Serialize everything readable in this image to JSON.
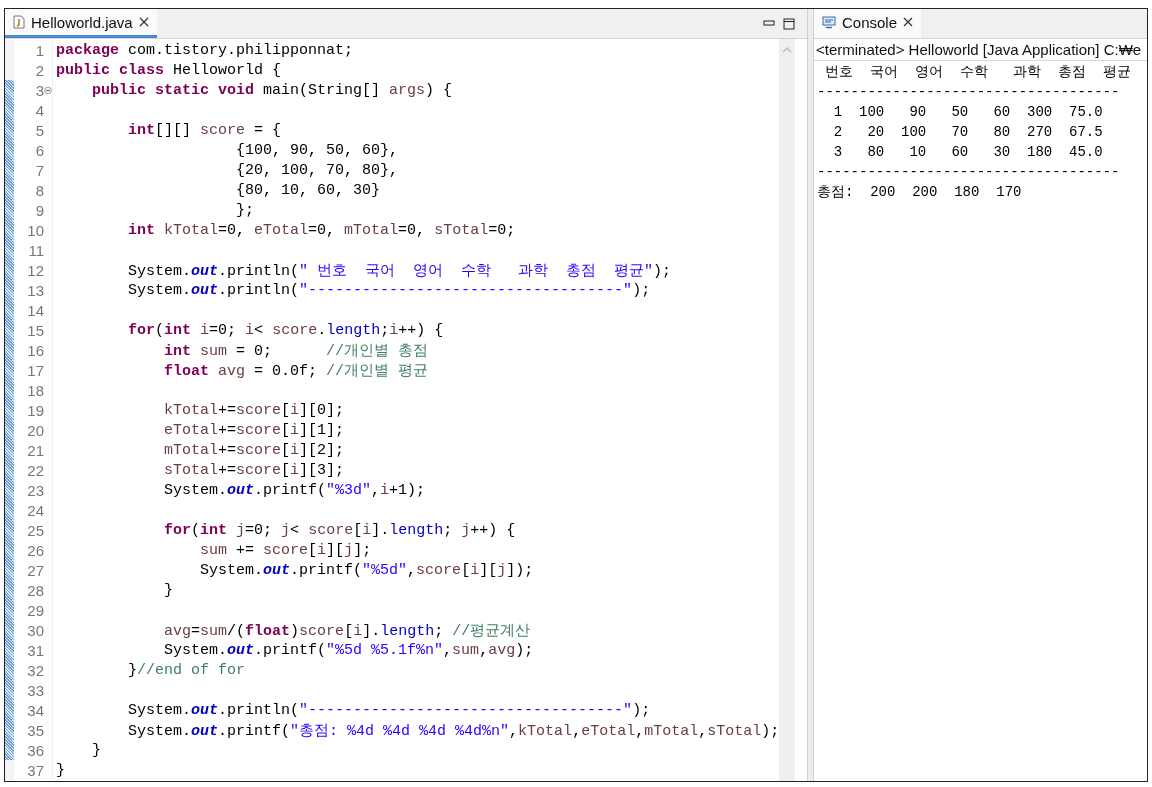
{
  "editor": {
    "tab": {
      "title": "Helloworld.java",
      "active": true
    },
    "lines": [
      {
        "number": "1",
        "fold": false,
        "marked": false,
        "tokens": [
          {
            "kind": "keyword",
            "text": "package"
          },
          {
            "kind": "plain",
            "text": " com.tistory.philipponnat;"
          }
        ]
      },
      {
        "number": "2",
        "fold": false,
        "marked": false,
        "tokens": [
          {
            "kind": "keyword",
            "text": "public class"
          },
          {
            "kind": "plain",
            "text": " Helloworld {"
          }
        ]
      },
      {
        "number": "3",
        "fold": true,
        "marked": true,
        "tokens": [
          {
            "kind": "keyword",
            "text": "    public static void"
          },
          {
            "kind": "plain",
            "text": " main(String[] "
          },
          {
            "kind": "variable",
            "text": "args"
          },
          {
            "kind": "plain",
            "text": ") {"
          }
        ]
      },
      {
        "number": "4",
        "fold": false,
        "marked": true
      },
      {
        "number": "5",
        "fold": false,
        "marked": true,
        "tokens": [
          {
            "kind": "keyword",
            "text": "        int"
          },
          {
            "kind": "plain",
            "text": "[][] "
          },
          {
            "kind": "variable",
            "text": "score"
          },
          {
            "kind": "plain",
            "text": " = {"
          }
        ]
      },
      {
        "number": "6",
        "fold": false,
        "marked": true,
        "tokens": [
          {
            "kind": "plain",
            "text": "                    {100, 90, 50, 60},"
          }
        ]
      },
      {
        "number": "7",
        "fold": false,
        "marked": true,
        "tokens": [
          {
            "kind": "plain",
            "text": "                    {20, 100, 70, 80},"
          }
        ]
      },
      {
        "number": "8",
        "fold": false,
        "marked": true,
        "tokens": [
          {
            "kind": "plain",
            "text": "                    {80, 10, 60, 30}"
          }
        ]
      },
      {
        "number": "9",
        "fold": false,
        "marked": true,
        "tokens": [
          {
            "kind": "plain",
            "text": "                    };"
          }
        ]
      },
      {
        "number": "10",
        "fold": false,
        "marked": true,
        "tokens": [
          {
            "kind": "keyword",
            "text": "        int "
          },
          {
            "kind": "variable",
            "text": "kTotal"
          },
          {
            "kind": "plain",
            "text": "=0, "
          },
          {
            "kind": "variable",
            "text": "eTotal"
          },
          {
            "kind": "plain",
            "text": "=0, "
          },
          {
            "kind": "variable",
            "text": "mTotal"
          },
          {
            "kind": "plain",
            "text": "=0, "
          },
          {
            "kind": "variable",
            "text": "sTotal"
          },
          {
            "kind": "plain",
            "text": "=0;"
          }
        ]
      },
      {
        "number": "11",
        "fold": false,
        "marked": true
      },
      {
        "number": "12",
        "fold": false,
        "marked": true,
        "tokens": [
          {
            "kind": "plain",
            "text": "        System."
          },
          {
            "kind": "static",
            "text": "out"
          },
          {
            "kind": "plain",
            "text": ".println("
          },
          {
            "kind": "string",
            "text": "\" 번호  국어  영어  수학   과학  총점  평균\""
          },
          {
            "kind": "plain",
            "text": ");"
          }
        ]
      },
      {
        "number": "13",
        "fold": false,
        "marked": true,
        "tokens": [
          {
            "kind": "plain",
            "text": "        System."
          },
          {
            "kind": "static",
            "text": "out"
          },
          {
            "kind": "plain",
            "text": ".println("
          },
          {
            "kind": "string",
            "text": "\"-----------------------------------\""
          },
          {
            "kind": "plain",
            "text": ");"
          }
        ]
      },
      {
        "number": "14",
        "fold": false,
        "marked": true
      },
      {
        "number": "15",
        "fold": false,
        "marked": true,
        "tokens": [
          {
            "kind": "keyword",
            "text": "        for"
          },
          {
            "kind": "plain",
            "text": "("
          },
          {
            "kind": "keyword",
            "text": "int "
          },
          {
            "kind": "variable",
            "text": "i"
          },
          {
            "kind": "plain",
            "text": "=0; "
          },
          {
            "kind": "variable",
            "text": "i"
          },
          {
            "kind": "plain",
            "text": "< "
          },
          {
            "kind": "variable",
            "text": "score"
          },
          {
            "kind": "plain",
            "text": "."
          },
          {
            "kind": "field",
            "text": "length"
          },
          {
            "kind": "plain",
            "text": ";"
          },
          {
            "kind": "variable",
            "text": "i"
          },
          {
            "kind": "plain",
            "text": "++) {"
          }
        ]
      },
      {
        "number": "16",
        "fold": false,
        "marked": true,
        "tokens": [
          {
            "kind": "keyword",
            "text": "            int "
          },
          {
            "kind": "variable",
            "text": "sum"
          },
          {
            "kind": "plain",
            "text": " = 0;      "
          },
          {
            "kind": "comment",
            "text": "//개인별 총점"
          }
        ]
      },
      {
        "number": "17",
        "fold": false,
        "marked": true,
        "tokens": [
          {
            "kind": "keyword",
            "text": "            float "
          },
          {
            "kind": "variable",
            "text": "avg"
          },
          {
            "kind": "plain",
            "text": " = 0.0f; "
          },
          {
            "kind": "comment",
            "text": "//개인별 평균"
          }
        ]
      },
      {
        "number": "18",
        "fold": false,
        "marked": true
      },
      {
        "number": "19",
        "fold": false,
        "marked": true,
        "tokens": [
          {
            "kind": "variable",
            "text": "            kTotal"
          },
          {
            "kind": "plain",
            "text": "+="
          },
          {
            "kind": "variable",
            "text": "score"
          },
          {
            "kind": "plain",
            "text": "["
          },
          {
            "kind": "variable",
            "text": "i"
          },
          {
            "kind": "plain",
            "text": "][0];"
          }
        ]
      },
      {
        "number": "20",
        "fold": false,
        "marked": true,
        "tokens": [
          {
            "kind": "variable",
            "text": "            eTotal"
          },
          {
            "kind": "plain",
            "text": "+="
          },
          {
            "kind": "variable",
            "text": "score"
          },
          {
            "kind": "plain",
            "text": "["
          },
          {
            "kind": "variable",
            "text": "i"
          },
          {
            "kind": "plain",
            "text": "][1];"
          }
        ]
      },
      {
        "number": "21",
        "fold": false,
        "marked": true,
        "tokens": [
          {
            "kind": "variable",
            "text": "            mTotal"
          },
          {
            "kind": "plain",
            "text": "+="
          },
          {
            "kind": "variable",
            "text": "score"
          },
          {
            "kind": "plain",
            "text": "["
          },
          {
            "kind": "variable",
            "text": "i"
          },
          {
            "kind": "plain",
            "text": "][2];"
          }
        ]
      },
      {
        "number": "22",
        "fold": false,
        "marked": true,
        "tokens": [
          {
            "kind": "variable",
            "text": "            sTotal"
          },
          {
            "kind": "plain",
            "text": "+="
          },
          {
            "kind": "variable",
            "text": "score"
          },
          {
            "kind": "plain",
            "text": "["
          },
          {
            "kind": "variable",
            "text": "i"
          },
          {
            "kind": "plain",
            "text": "][3];"
          }
        ]
      },
      {
        "number": "23",
        "fold": false,
        "marked": true,
        "tokens": [
          {
            "kind": "plain",
            "text": "            System."
          },
          {
            "kind": "static",
            "text": "out"
          },
          {
            "kind": "plain",
            "text": ".printf("
          },
          {
            "kind": "string",
            "text": "\"%3d\""
          },
          {
            "kind": "plain",
            "text": ","
          },
          {
            "kind": "variable",
            "text": "i"
          },
          {
            "kind": "plain",
            "text": "+1);"
          }
        ]
      },
      {
        "number": "24",
        "fold": false,
        "marked": true
      },
      {
        "number": "25",
        "fold": false,
        "marked": true,
        "tokens": [
          {
            "kind": "keyword",
            "text": "            for"
          },
          {
            "kind": "plain",
            "text": "("
          },
          {
            "kind": "keyword",
            "text": "int "
          },
          {
            "kind": "variable",
            "text": "j"
          },
          {
            "kind": "plain",
            "text": "=0; "
          },
          {
            "kind": "variable",
            "text": "j"
          },
          {
            "kind": "plain",
            "text": "< "
          },
          {
            "kind": "variable",
            "text": "score"
          },
          {
            "kind": "plain",
            "text": "["
          },
          {
            "kind": "variable",
            "text": "i"
          },
          {
            "kind": "plain",
            "text": "]."
          },
          {
            "kind": "field",
            "text": "length"
          },
          {
            "kind": "plain",
            "text": "; "
          },
          {
            "kind": "variable",
            "text": "j"
          },
          {
            "kind": "plain",
            "text": "++) {"
          }
        ]
      },
      {
        "number": "26",
        "fold": false,
        "marked": true,
        "tokens": [
          {
            "kind": "variable",
            "text": "                sum"
          },
          {
            "kind": "plain",
            "text": " += "
          },
          {
            "kind": "variable",
            "text": "score"
          },
          {
            "kind": "plain",
            "text": "["
          },
          {
            "kind": "variable",
            "text": "i"
          },
          {
            "kind": "plain",
            "text": "]["
          },
          {
            "kind": "variable",
            "text": "j"
          },
          {
            "kind": "plain",
            "text": "];"
          }
        ]
      },
      {
        "number": "27",
        "fold": false,
        "marked": true,
        "tokens": [
          {
            "kind": "plain",
            "text": "                System."
          },
          {
            "kind": "static",
            "text": "out"
          },
          {
            "kind": "plain",
            "text": ".printf("
          },
          {
            "kind": "string",
            "text": "\"%5d\""
          },
          {
            "kind": "plain",
            "text": ","
          },
          {
            "kind": "variable",
            "text": "score"
          },
          {
            "kind": "plain",
            "text": "["
          },
          {
            "kind": "variable",
            "text": "i"
          },
          {
            "kind": "plain",
            "text": "]["
          },
          {
            "kind": "variable",
            "text": "j"
          },
          {
            "kind": "plain",
            "text": "]);"
          }
        ]
      },
      {
        "number": "28",
        "fold": false,
        "marked": true,
        "tokens": [
          {
            "kind": "plain",
            "text": "            }"
          }
        ]
      },
      {
        "number": "29",
        "fold": false,
        "marked": true
      },
      {
        "number": "30",
        "fold": false,
        "marked": true,
        "tokens": [
          {
            "kind": "variable",
            "text": "            avg"
          },
          {
            "kind": "plain",
            "text": "="
          },
          {
            "kind": "variable",
            "text": "sum"
          },
          {
            "kind": "plain",
            "text": "/("
          },
          {
            "kind": "keyword",
            "text": "float"
          },
          {
            "kind": "plain",
            "text": ")"
          },
          {
            "kind": "variable",
            "text": "score"
          },
          {
            "kind": "plain",
            "text": "["
          },
          {
            "kind": "variable",
            "text": "i"
          },
          {
            "kind": "plain",
            "text": "]."
          },
          {
            "kind": "field",
            "text": "length"
          },
          {
            "kind": "plain",
            "text": "; "
          },
          {
            "kind": "comment",
            "text": "//평균계산"
          }
        ]
      },
      {
        "number": "31",
        "fold": false,
        "marked": true,
        "tokens": [
          {
            "kind": "plain",
            "text": "            System."
          },
          {
            "kind": "static",
            "text": "out"
          },
          {
            "kind": "plain",
            "text": ".printf("
          },
          {
            "kind": "string",
            "text": "\"%5d %5.1f%n\""
          },
          {
            "kind": "plain",
            "text": ","
          },
          {
            "kind": "variable",
            "text": "sum"
          },
          {
            "kind": "plain",
            "text": ","
          },
          {
            "kind": "variable",
            "text": "avg"
          },
          {
            "kind": "plain",
            "text": ");"
          }
        ]
      },
      {
        "number": "32",
        "fold": false,
        "marked": true,
        "tokens": [
          {
            "kind": "plain",
            "text": "        }"
          },
          {
            "kind": "comment",
            "text": "//end of for"
          }
        ]
      },
      {
        "number": "33",
        "fold": false,
        "marked": true
      },
      {
        "number": "34",
        "fold": false,
        "marked": true,
        "tokens": [
          {
            "kind": "plain",
            "text": "        System."
          },
          {
            "kind": "static",
            "text": "out"
          },
          {
            "kind": "plain",
            "text": ".println("
          },
          {
            "kind": "string",
            "text": "\"-----------------------------------\""
          },
          {
            "kind": "plain",
            "text": ");"
          }
        ]
      },
      {
        "number": "35",
        "fold": false,
        "marked": true,
        "tokens": [
          {
            "kind": "plain",
            "text": "        System."
          },
          {
            "kind": "static",
            "text": "out"
          },
          {
            "kind": "plain",
            "text": ".printf("
          },
          {
            "kind": "string",
            "text": "\"총점: %4d %4d %4d %4d%n\""
          },
          {
            "kind": "plain",
            "text": ","
          },
          {
            "kind": "variable",
            "text": "kTotal"
          },
          {
            "kind": "plain",
            "text": ","
          },
          {
            "kind": "variable",
            "text": "eTotal"
          },
          {
            "kind": "plain",
            "text": ","
          },
          {
            "kind": "variable",
            "text": "mTotal"
          },
          {
            "kind": "plain",
            "text": ","
          },
          {
            "kind": "variable",
            "text": "sTotal"
          },
          {
            "kind": "plain",
            "text": ");"
          }
        ]
      },
      {
        "number": "36",
        "fold": false,
        "marked": true,
        "tokens": [
          {
            "kind": "plain",
            "text": "    }"
          }
        ]
      },
      {
        "number": "37",
        "fold": false,
        "marked": false,
        "tokens": [
          {
            "kind": "plain",
            "text": "}"
          }
        ]
      }
    ]
  },
  "console": {
    "tab": {
      "title": "Console",
      "active": false
    },
    "status": "<terminated> Helloworld [Java Application] C:₩e",
    "output": [
      " 번호  국어  영어  수학   과학  총점  평균",
      "------------------------------------",
      "  1  100   90   50   60  300  75.0",
      "  2   20  100   70   80  270  67.5",
      "  3   80   10   60   30  180  45.0",
      "------------------------------------",
      "총점:  200  200  180  170"
    ]
  }
}
